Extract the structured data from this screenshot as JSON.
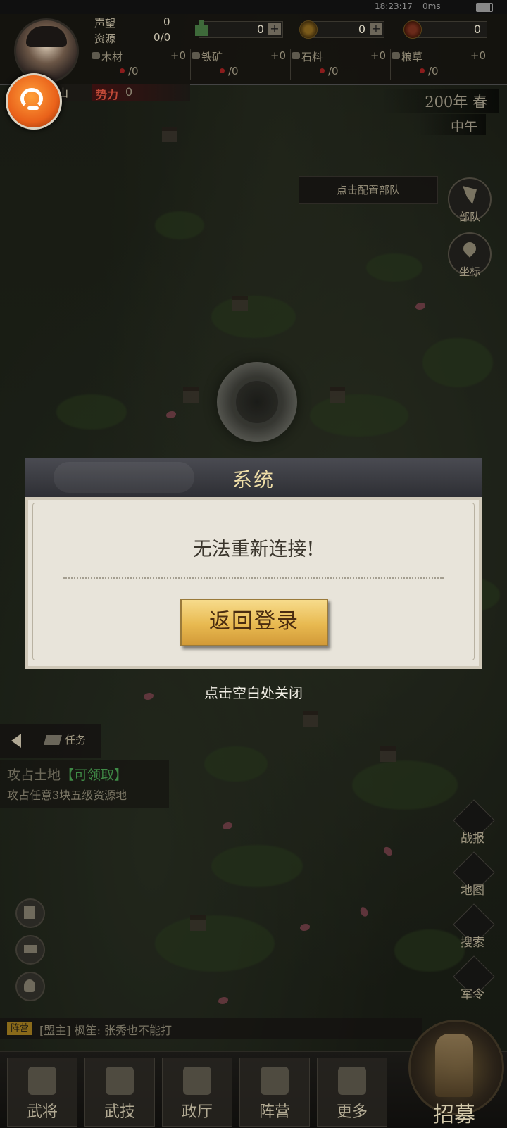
{
  "status_bar": {
    "time": "18:23:17",
    "network": "0ms"
  },
  "player": {
    "name_fragment": "山",
    "reputation_label": "声望",
    "reputation_value": "0",
    "resource_label": "资源",
    "resource_value": "0/0",
    "power_label": "势力",
    "power_value": "0"
  },
  "currencies": [
    {
      "icon": "tower-icon",
      "value": "0"
    },
    {
      "icon": "copper-coin-icon",
      "value": "0"
    },
    {
      "icon": "gold-coin-icon",
      "value": "0"
    }
  ],
  "materials": [
    {
      "name": "木材",
      "gain": "+0",
      "count": "/0"
    },
    {
      "name": "铁矿",
      "gain": "+0",
      "count": "/0"
    },
    {
      "name": "石料",
      "gain": "+0",
      "count": "/0"
    },
    {
      "name": "粮草",
      "gain": "+0",
      "count": "/0"
    }
  ],
  "season": {
    "year": "200年 春",
    "time_of_day": "中午"
  },
  "map_tip": "点击配置部队",
  "right_buttons": {
    "troops": "部队",
    "coords": "坐标"
  },
  "dialog": {
    "title": "系统",
    "message": "无法重新连接!",
    "button": "返回登录",
    "close_hint": "点击空白处关闭"
  },
  "task": {
    "tab_label": "任务",
    "title": "攻占土地",
    "claim": "【可领取】",
    "description": "攻占任意3块五级资源地"
  },
  "side_buttons": [
    "战报",
    "地图",
    "搜索",
    "军令"
  ],
  "chat": {
    "tag": "阵营",
    "text": "[盟主] 枫笙: 张秀也不能打"
  },
  "bottom_nav": [
    "武将",
    "武技",
    "政厅",
    "阵营",
    "更多"
  ],
  "recruit": "招募",
  "colors": {
    "accent_gold": "#f0dfa8",
    "button_gold": "#e8b950",
    "claim_green": "#3f8a46"
  }
}
